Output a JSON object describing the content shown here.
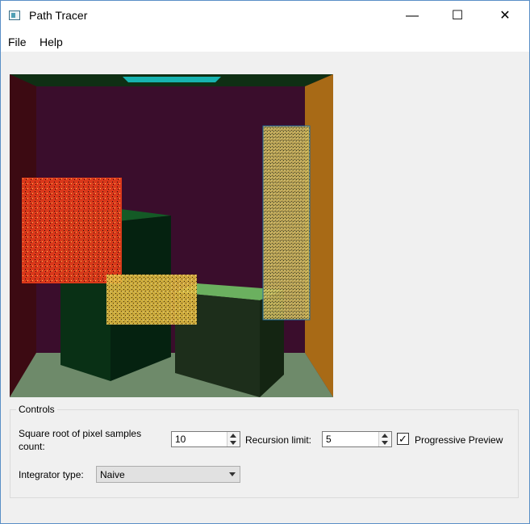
{
  "window": {
    "title": "Path Tracer",
    "minimize_glyph": "—",
    "maximize_glyph": "☐",
    "close_glyph": "✕"
  },
  "menu": {
    "items": [
      "File",
      "Help"
    ]
  },
  "render_view": {
    "scene": "cornell box with boxes",
    "colors": {
      "back_wall": "#3a0d2c",
      "left_wall": "#3c0a12",
      "right_wall": "#a86a16",
      "ceiling": "#0f2f14",
      "floor": "#6e8a6a",
      "light": "#17b3b0",
      "tall_box_front": "#093015",
      "tall_box_top": "#145a26",
      "short_box_front": "#1d2e1b",
      "short_box_top": "#6bb05f",
      "noise_left": "#e23a1a",
      "noise_mid": "#e0b840",
      "noise_right": "#c8b45a",
      "selection_outline": "#1c6aa0"
    }
  },
  "controls": {
    "group_title": "Controls",
    "samples_label_line1": "Square root of pixel samples",
    "samples_label_line2": "count:",
    "samples_value": "10",
    "recursion_label": "Recursion limit:",
    "recursion_value": "5",
    "progressive_label": "Progressive Preview",
    "progressive_checked": "✓",
    "integrator_label": "Integrator type:",
    "integrator_value": "Naive"
  }
}
